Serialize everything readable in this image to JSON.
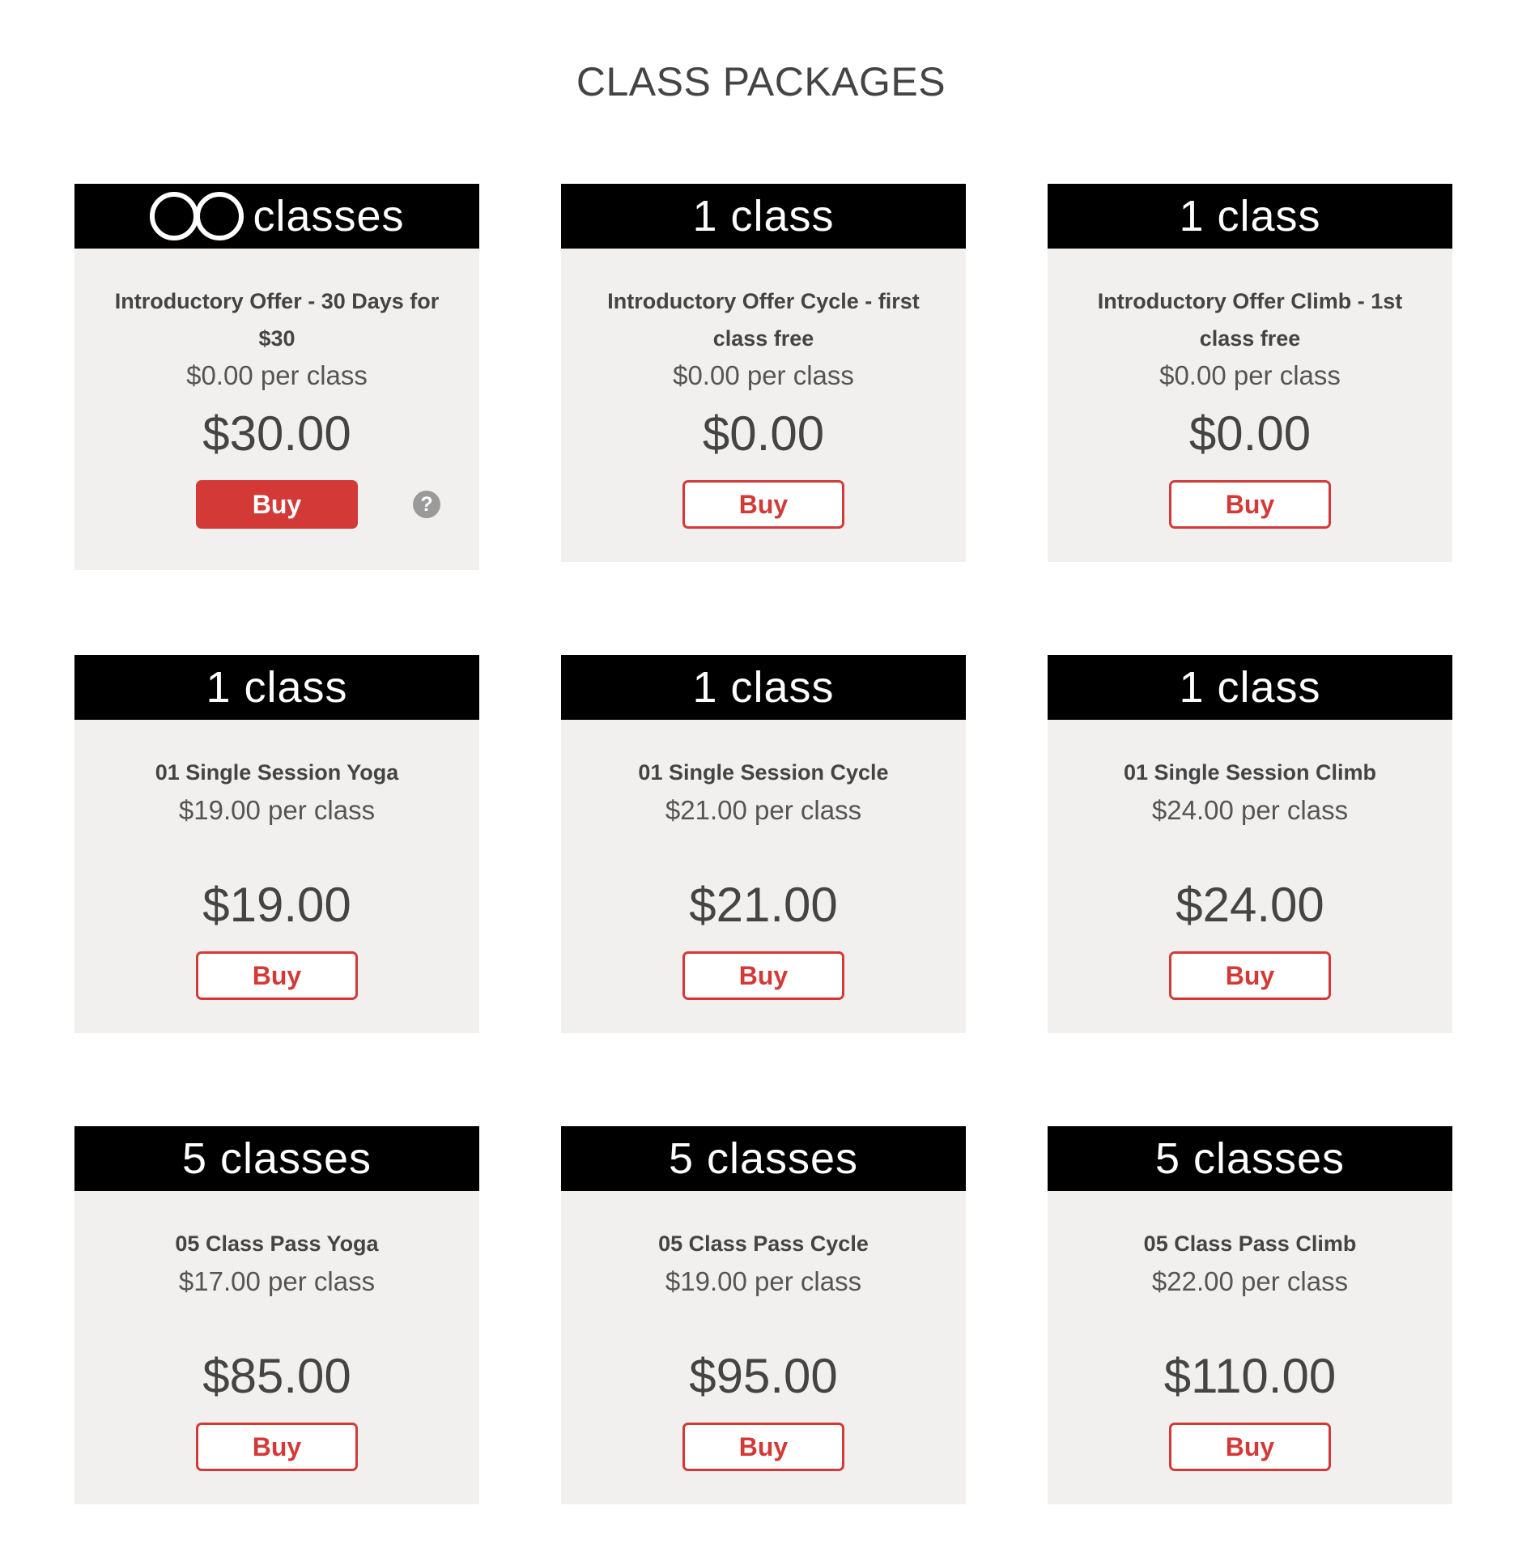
{
  "page": {
    "title": "CLASS PACKAGES"
  },
  "colors": {
    "accent": "#d33a37",
    "header_bg": "#000000",
    "card_bg": "#f1f0ef",
    "text": "#444444"
  },
  "packages": [
    {
      "header_count_icon": "infinity-icon",
      "header_label": "classes",
      "name": "Introductory Offer - 30 Days for $30",
      "per_class": "$0.00 per class",
      "price": "$30.00",
      "buy_label": "Buy",
      "buy_style": "filled",
      "help_icon": "?"
    },
    {
      "header_label": "1 class",
      "name": "Introductory Offer Cycle - first class free",
      "per_class": "$0.00 per class",
      "price": "$0.00",
      "buy_label": "Buy",
      "buy_style": "outline"
    },
    {
      "header_label": "1 class",
      "name": "Introductory Offer Climb - 1st class free",
      "per_class": "$0.00 per class",
      "price": "$0.00",
      "buy_label": "Buy",
      "buy_style": "outline"
    },
    {
      "header_label": "1 class",
      "name": "01 Single Session Yoga",
      "per_class": "$19.00 per class",
      "price": "$19.00",
      "buy_label": "Buy",
      "buy_style": "outline"
    },
    {
      "header_label": "1 class",
      "name": "01 Single Session Cycle",
      "per_class": "$21.00 per class",
      "price": "$21.00",
      "buy_label": "Buy",
      "buy_style": "outline"
    },
    {
      "header_label": "1 class",
      "name": "01 Single Session Climb",
      "per_class": "$24.00 per class",
      "price": "$24.00",
      "buy_label": "Buy",
      "buy_style": "outline"
    },
    {
      "header_label": "5 classes",
      "name": "05 Class Pass Yoga",
      "per_class": "$17.00 per class",
      "price": "$85.00",
      "buy_label": "Buy",
      "buy_style": "outline"
    },
    {
      "header_label": "5 classes",
      "name": "05 Class Pass Cycle",
      "per_class": "$19.00 per class",
      "price": "$95.00",
      "buy_label": "Buy",
      "buy_style": "outline"
    },
    {
      "header_label": "5 classes",
      "name": "05 Class Pass Climb",
      "per_class": "$22.00 per class",
      "price": "$110.00",
      "buy_label": "Buy",
      "buy_style": "outline"
    }
  ]
}
